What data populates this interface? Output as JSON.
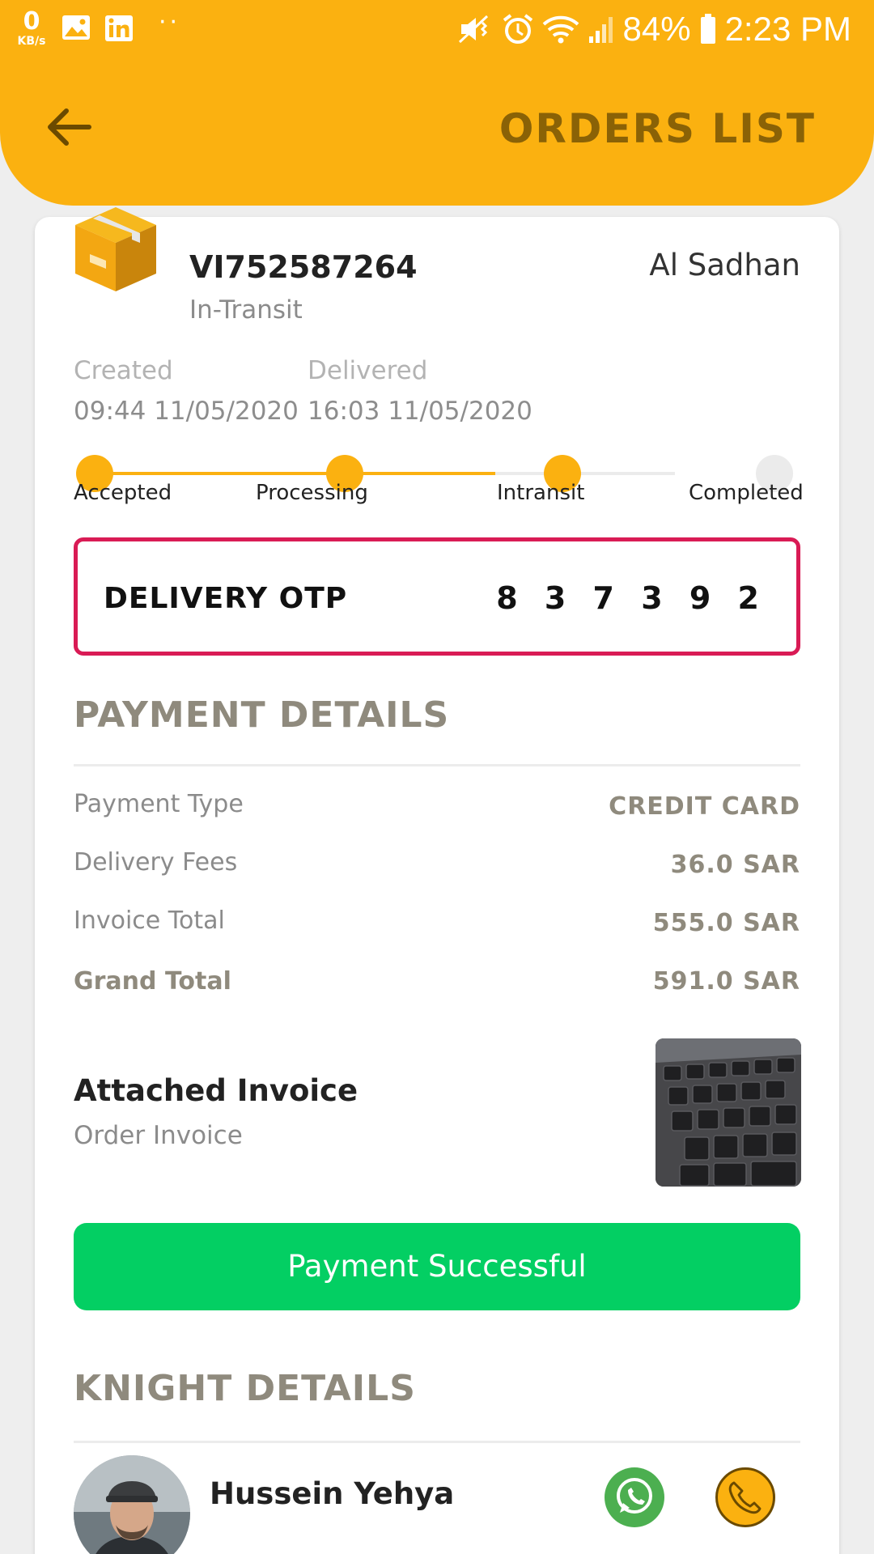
{
  "status_bar": {
    "net_speed": "0",
    "net_unit": "KB/s",
    "dots": "··",
    "battery": "84%",
    "time": "2:23 PM"
  },
  "header": {
    "title": "ORDERS LIST",
    "back_icon": "arrow-left-icon"
  },
  "order": {
    "id": "VI752587264",
    "status": "In-Transit",
    "merchant": "Al Sadhan",
    "created_label": "Created",
    "created_value": "09:44 11/05/2020",
    "delivered_label": "Delivered",
    "delivered_value": "16:03 11/05/2020"
  },
  "progress": {
    "steps": [
      {
        "label": "Accepted",
        "done": true
      },
      {
        "label": "Processing",
        "done": true
      },
      {
        "label": "Intransit",
        "done": true
      },
      {
        "label": "Completed",
        "done": false
      }
    ]
  },
  "otp": {
    "label": "DELIVERY OTP",
    "code": "8 3 7 3 9 2"
  },
  "payment": {
    "title": "PAYMENT DETAILS",
    "rows": [
      {
        "label": "Payment Type",
        "value": "CREDIT CARD"
      },
      {
        "label": "Delivery Fees",
        "value": "36.0 SAR"
      },
      {
        "label": "Invoice Total",
        "value": "555.0 SAR"
      },
      {
        "label": "Grand Total",
        "value": "591.0 SAR"
      }
    ]
  },
  "invoice": {
    "title": "Attached Invoice",
    "subtitle": "Order Invoice"
  },
  "payment_button": "Payment Successful",
  "knight": {
    "title": "KNIGHT DETAILS",
    "name": "Hussein Yehya"
  },
  "colors": {
    "accent": "#fbb110",
    "otp_border": "#d91b55",
    "success": "#03cf63",
    "section_title": "#8f8a7d"
  }
}
